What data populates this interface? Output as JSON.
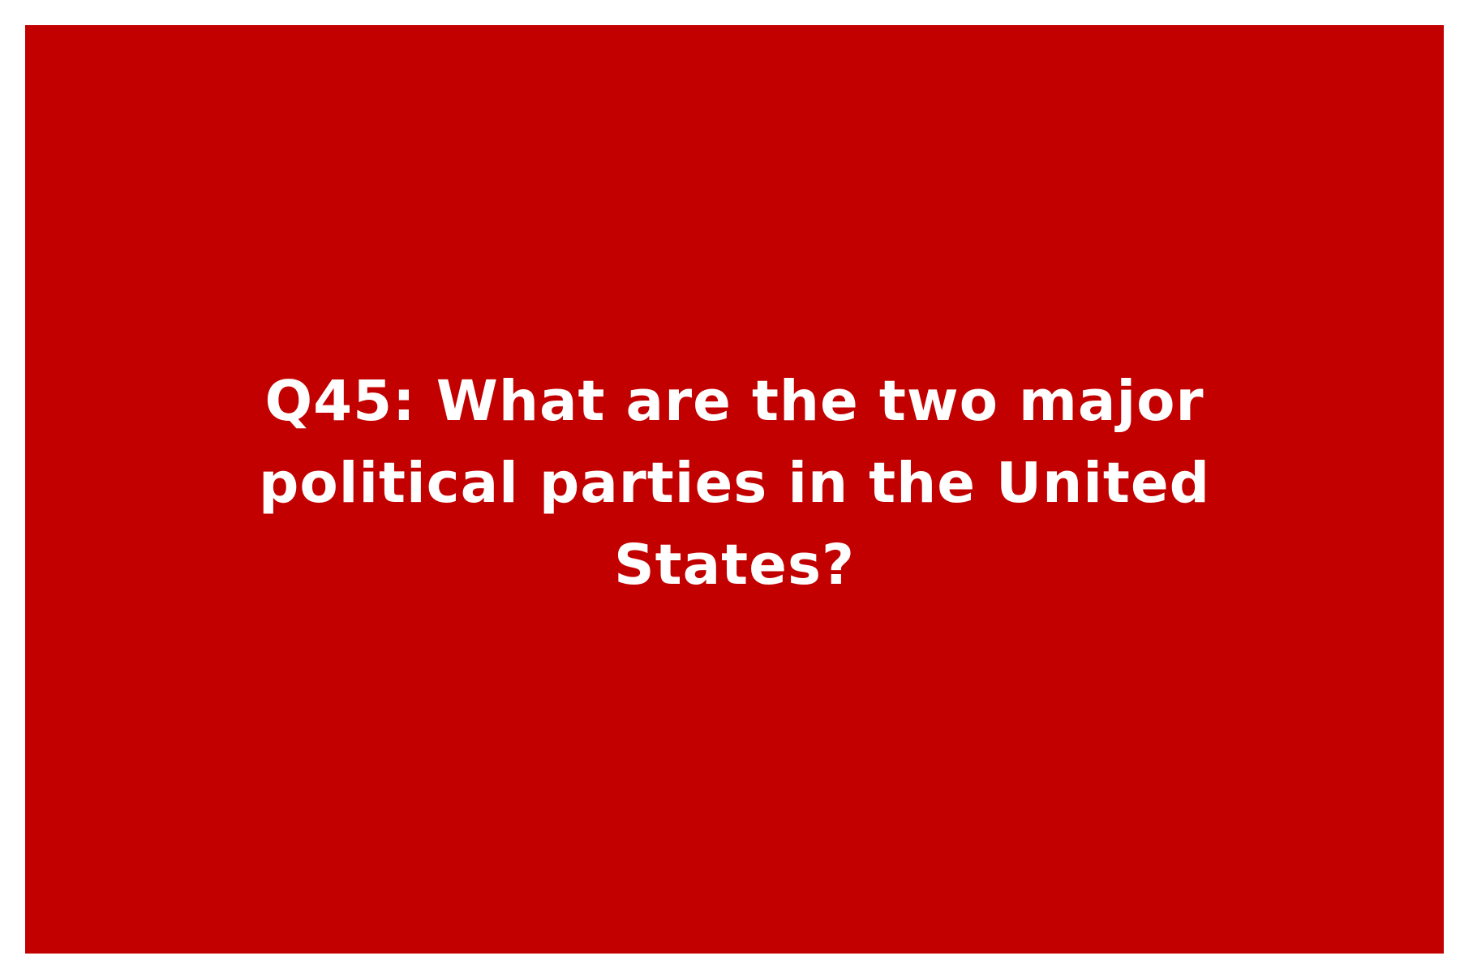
{
  "card": {
    "background_color": "#c30000",
    "text_color": "#ffffff",
    "question": "Q45: What are the two major political parties in the United States?"
  }
}
